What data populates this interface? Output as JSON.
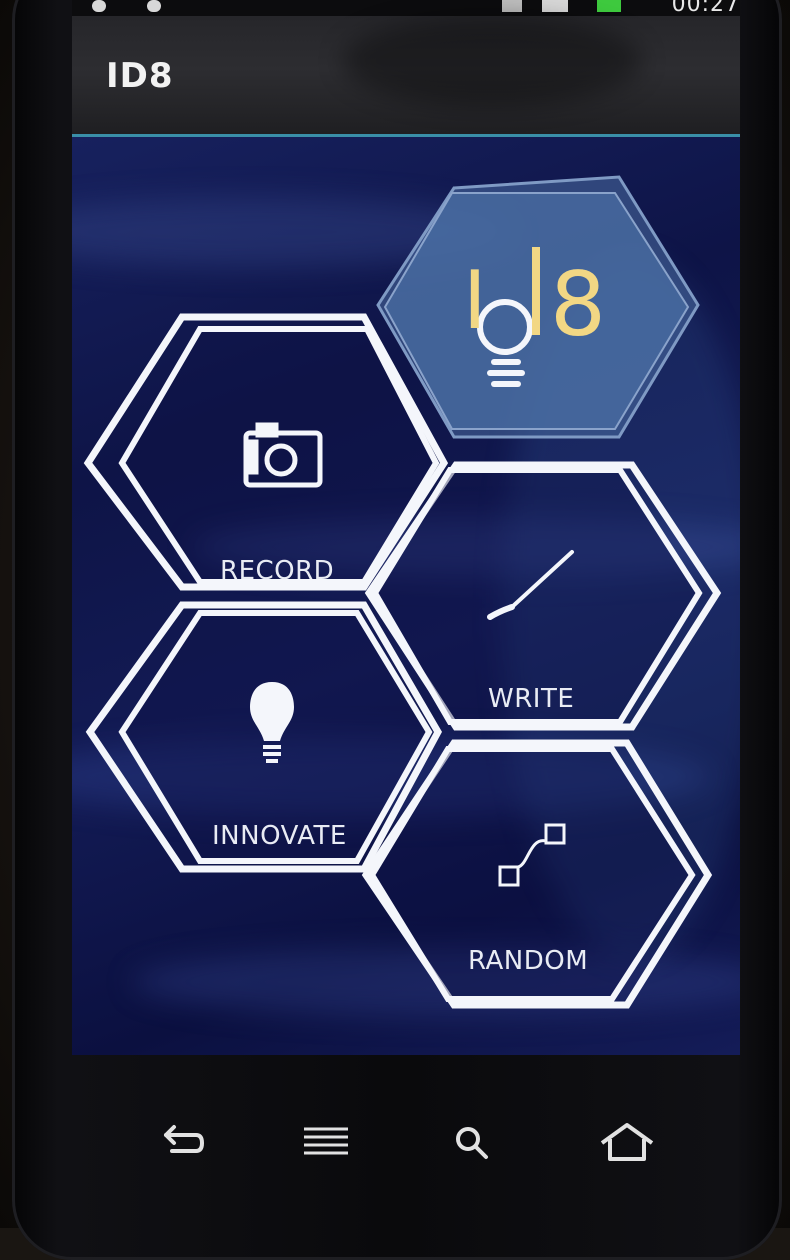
{
  "status_bar": {
    "clock": "00:27"
  },
  "app_bar": {
    "title": "ID8"
  },
  "logo": {
    "text_before": "I",
    "text_after": "8",
    "text_color": "#f2d784"
  },
  "menu": {
    "record_label": "RECORD",
    "write_label": "WRITE",
    "innovate_label": "INNOVATE",
    "random_label": "RANDOM"
  },
  "icons": {
    "record": "camera-icon",
    "write": "pen-icon",
    "innovate": "lightbulb-icon",
    "random": "connected-squares-icon",
    "back": "back-icon",
    "menu": "menu-icon",
    "search": "search-icon",
    "home": "home-icon"
  },
  "colors": {
    "background_blue": "#101650",
    "hex_outline": "#f4f6fb",
    "logo_hex": "#4a6ea3",
    "divider": "#3a8fa8"
  }
}
